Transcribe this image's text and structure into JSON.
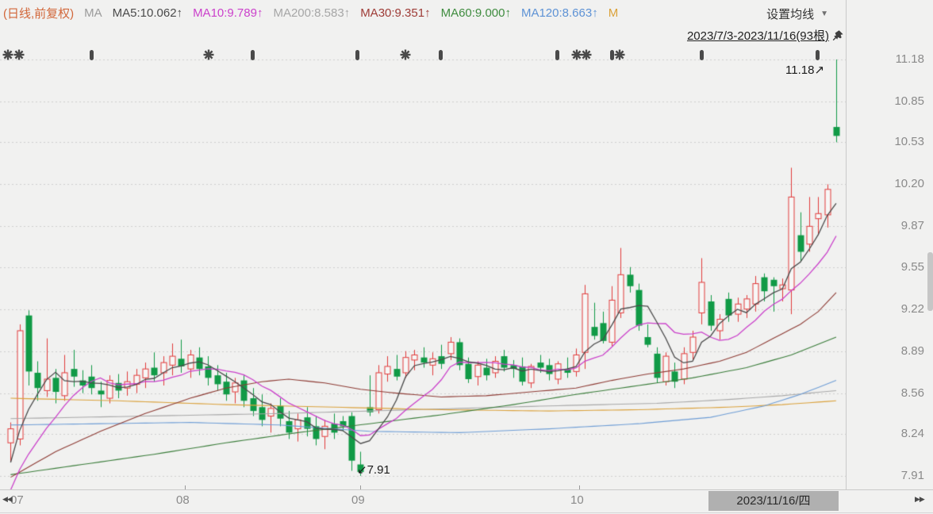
{
  "colors": {
    "background": "#f1f1f0",
    "grid": "#cfcfcf",
    "up": "#e13b3b",
    "up_fill": "#f7f7f6",
    "down": "#109a46",
    "axis_text": "#8a8a8a",
    "separator": "#c9c9c9",
    "annotation": "#1b1b1b",
    "marker": "#4a4a4a",
    "date_box_bg": "#b0b0b0",
    "date_box_text": "#2b2b2b",
    "scrollbar_thumb": "#c6c6c6"
  },
  "header": {
    "items": [
      {
        "name": "period-mode-label",
        "text": "(日线,前复权)",
        "color": "#d2673a"
      },
      {
        "name": "ma-group-label",
        "text": "MA",
        "color": "#9b9b9b"
      },
      {
        "name": "ma5-value",
        "text": "MA5:10.062↑",
        "color": "#4a4a4a"
      },
      {
        "name": "ma10-value",
        "text": "MA10:9.789↑",
        "color": "#cb41cb"
      },
      {
        "name": "ma200-value",
        "text": "MA200:8.583↑",
        "color": "#a6a6a6"
      },
      {
        "name": "ma30-value",
        "text": "MA30:9.351↑",
        "color": "#9e3b36"
      },
      {
        "name": "ma60-value",
        "text": "MA60:9.000↑",
        "color": "#3f8c3f"
      },
      {
        "name": "ma120-value",
        "text": "MA120:8.663↑",
        "color": "#5d92d5"
      },
      {
        "name": "ma250-truncated",
        "text": "M",
        "color": "#dba23a"
      }
    ],
    "settings_label": "设置均线",
    "date_range": "2023/7/3-2023/11/16(93根)"
  },
  "footer": {
    "month_labels": [
      {
        "label": "07",
        "x": 13
      },
      {
        "label": "08",
        "x": 233
      },
      {
        "label": "09",
        "x": 454
      },
      {
        "label": "10",
        "x": 730
      }
    ],
    "current_date": "2023/11/16/四"
  },
  "chart_data": {
    "type": "candlestick",
    "title": "日线 (daily) candlestick chart with moving averages",
    "date_start": "2023/7/3",
    "date_end": "2023/11/16",
    "bars_count": 93,
    "ylim": [
      7.91,
      11.18
    ],
    "price_axis_labels": [
      11.18,
      10.85,
      10.53,
      10.2,
      9.87,
      9.55,
      9.22,
      8.89,
      8.56,
      8.24,
      7.91
    ],
    "grid": "dotted-horizontal",
    "annotations": {
      "high": {
        "text": "11.18",
        "arrow": "↗",
        "price": 11.18
      },
      "low": {
        "text": "7.91",
        "arrow": "↙",
        "price": 7.91
      }
    },
    "ohlc": [
      [
        8.17,
        8.33,
        8.02,
        8.28
      ],
      [
        8.2,
        9.1,
        8.15,
        9.05
      ],
      [
        9.17,
        9.21,
        8.62,
        8.73
      ],
      [
        8.72,
        8.81,
        8.5,
        8.6
      ],
      [
        8.58,
        8.99,
        8.53,
        8.67
      ],
      [
        8.68,
        8.75,
        8.48,
        8.57
      ],
      [
        8.54,
        8.86,
        8.5,
        8.72
      ],
      [
        8.75,
        8.9,
        8.61,
        8.69
      ],
      [
        8.66,
        8.74,
        8.56,
        8.62
      ],
      [
        8.69,
        8.78,
        8.55,
        8.6
      ],
      [
        8.58,
        8.65,
        8.45,
        8.55
      ],
      [
        8.52,
        8.7,
        8.48,
        8.66
      ],
      [
        8.64,
        8.71,
        8.52,
        8.58
      ],
      [
        8.6,
        8.73,
        8.54,
        8.65
      ],
      [
        8.63,
        8.75,
        8.56,
        8.7
      ],
      [
        8.68,
        8.8,
        8.6,
        8.75
      ],
      [
        8.76,
        8.88,
        8.65,
        8.7
      ],
      [
        8.72,
        8.85,
        8.62,
        8.8
      ],
      [
        8.78,
        8.95,
        8.7,
        8.85
      ],
      [
        8.83,
        8.98,
        8.72,
        8.77
      ],
      [
        8.75,
        8.9,
        8.68,
        8.86
      ],
      [
        8.84,
        8.92,
        8.7,
        8.75
      ],
      [
        8.77,
        8.85,
        8.62,
        8.68
      ],
      [
        8.7,
        8.78,
        8.58,
        8.63
      ],
      [
        8.65,
        8.72,
        8.5,
        8.55
      ],
      [
        8.57,
        8.68,
        8.48,
        8.64
      ],
      [
        8.66,
        8.7,
        8.45,
        8.5
      ],
      [
        8.52,
        8.6,
        8.38,
        8.42
      ],
      [
        8.45,
        8.55,
        8.3,
        8.35
      ],
      [
        8.38,
        8.48,
        8.25,
        8.44
      ],
      [
        8.46,
        8.52,
        8.3,
        8.36
      ],
      [
        8.34,
        8.42,
        8.2,
        8.25
      ],
      [
        8.28,
        8.4,
        8.18,
        8.35
      ],
      [
        8.37,
        8.45,
        8.22,
        8.28
      ],
      [
        8.3,
        8.38,
        8.15,
        8.2
      ],
      [
        8.22,
        8.35,
        8.12,
        8.3
      ],
      [
        8.32,
        8.4,
        8.2,
        8.25
      ],
      [
        8.34,
        8.38,
        8.26,
        8.3
      ],
      [
        8.38,
        8.41,
        7.95,
        8.03
      ],
      [
        8.0,
        8.1,
        7.91,
        7.94
      ],
      [
        8.45,
        8.7,
        8.38,
        8.41
      ],
      [
        8.43,
        8.78,
        8.4,
        8.72
      ],
      [
        8.71,
        8.85,
        8.65,
        8.77
      ],
      [
        8.75,
        8.86,
        8.66,
        8.69
      ],
      [
        8.72,
        8.89,
        8.68,
        8.84
      ],
      [
        8.82,
        8.9,
        8.74,
        8.86
      ],
      [
        8.84,
        8.92,
        8.76,
        8.8
      ],
      [
        8.78,
        8.88,
        8.7,
        8.83
      ],
      [
        8.85,
        8.94,
        8.75,
        8.79
      ],
      [
        8.87,
        9.0,
        8.82,
        8.96
      ],
      [
        8.96,
        8.99,
        8.74,
        8.78
      ],
      [
        8.79,
        8.84,
        8.64,
        8.67
      ],
      [
        8.69,
        8.81,
        8.62,
        8.78
      ],
      [
        8.76,
        8.83,
        8.66,
        8.7
      ],
      [
        8.72,
        8.85,
        8.68,
        8.81
      ],
      [
        8.85,
        8.9,
        8.73,
        8.76
      ],
      [
        8.78,
        8.82,
        8.68,
        8.75
      ],
      [
        8.77,
        8.84,
        8.62,
        8.65
      ],
      [
        8.64,
        8.79,
        8.6,
        8.77
      ],
      [
        8.8,
        8.86,
        8.72,
        8.76
      ],
      [
        8.78,
        8.83,
        8.66,
        8.71
      ],
      [
        8.67,
        8.81,
        8.63,
        8.79
      ],
      [
        8.75,
        8.84,
        8.68,
        8.72
      ],
      [
        8.73,
        8.91,
        8.69,
        8.86
      ],
      [
        8.88,
        9.41,
        8.75,
        9.34
      ],
      [
        9.08,
        9.27,
        8.98,
        9.01
      ],
      [
        9.11,
        9.2,
        8.95,
        8.97
      ],
      [
        8.96,
        9.4,
        8.93,
        9.29
      ],
      [
        9.19,
        9.7,
        9.15,
        9.49
      ],
      [
        9.49,
        9.55,
        9.35,
        9.4
      ],
      [
        9.37,
        9.42,
        9.05,
        9.09
      ],
      [
        9.0,
        9.1,
        8.92,
        8.94
      ],
      [
        8.87,
        8.92,
        8.64,
        8.68
      ],
      [
        8.65,
        8.88,
        8.62,
        8.85
      ],
      [
        8.73,
        8.8,
        8.6,
        8.65
      ],
      [
        8.67,
        8.92,
        8.63,
        8.87
      ],
      [
        8.88,
        9.05,
        8.82,
        9.0
      ],
      [
        9.19,
        9.62,
        9.1,
        9.43
      ],
      [
        9.28,
        9.33,
        9.05,
        9.09
      ],
      [
        9.05,
        9.18,
        8.98,
        9.14
      ],
      [
        9.3,
        9.35,
        9.12,
        9.17
      ],
      [
        9.18,
        9.31,
        9.12,
        9.26
      ],
      [
        9.22,
        9.33,
        9.15,
        9.3
      ],
      [
        9.26,
        9.48,
        9.2,
        9.42
      ],
      [
        9.47,
        9.5,
        9.28,
        9.36
      ],
      [
        9.45,
        9.47,
        9.2,
        9.4
      ],
      [
        9.38,
        9.46,
        9.28,
        9.41
      ],
      [
        9.37,
        10.33,
        9.18,
        10.1
      ],
      [
        9.8,
        9.98,
        9.59,
        9.67
      ],
      [
        9.73,
        10.1,
        9.67,
        9.87
      ],
      [
        9.93,
        10.1,
        9.8,
        9.97
      ],
      [
        9.96,
        10.2,
        9.86,
        10.16
      ],
      [
        10.65,
        11.18,
        10.53,
        10.58
      ]
    ],
    "pre_window_closes": [
      7.4,
      7.45,
      7.52,
      7.58,
      7.65,
      7.72,
      7.8,
      7.9,
      8.0,
      8.1
    ],
    "ma_computed": [
      {
        "name": "MA5",
        "period": 5,
        "color": "#4a4a4a",
        "last_value": 10.062
      },
      {
        "name": "MA10",
        "period": 10,
        "color": "#cb41cb",
        "last_value": 9.789
      }
    ],
    "ma_lines": [
      {
        "name": "MA200",
        "color": "#a8a8a8",
        "last_value": 8.583,
        "points": [
          [
            0,
            8.36
          ],
          [
            15,
            8.38
          ],
          [
            30,
            8.4
          ],
          [
            45,
            8.43
          ],
          [
            60,
            8.46
          ],
          [
            72,
            8.48
          ],
          [
            80,
            8.51
          ],
          [
            86,
            8.54
          ],
          [
            92,
            8.58
          ]
        ]
      },
      {
        "name": "MA250",
        "color": "#dba23c",
        "points": [
          [
            0,
            8.52
          ],
          [
            12,
            8.5
          ],
          [
            24,
            8.47
          ],
          [
            36,
            8.45
          ],
          [
            48,
            8.43
          ],
          [
            60,
            8.42
          ],
          [
            70,
            8.43
          ],
          [
            80,
            8.45
          ],
          [
            86,
            8.47
          ],
          [
            92,
            8.5
          ]
        ]
      },
      {
        "name": "MA120",
        "color": "#6f9ed6",
        "last_value": 8.663,
        "points": [
          [
            0,
            8.31
          ],
          [
            10,
            8.32
          ],
          [
            20,
            8.33
          ],
          [
            30,
            8.31
          ],
          [
            40,
            8.26
          ],
          [
            50,
            8.25
          ],
          [
            60,
            8.28
          ],
          [
            70,
            8.32
          ],
          [
            78,
            8.37
          ],
          [
            84,
            8.46
          ],
          [
            88,
            8.55
          ],
          [
            92,
            8.66
          ]
        ]
      },
      {
        "name": "MA60",
        "color": "#3a7d3a",
        "last_value": 9.0,
        "points": [
          [
            0,
            7.92
          ],
          [
            8,
            8.0
          ],
          [
            16,
            8.08
          ],
          [
            24,
            8.17
          ],
          [
            32,
            8.25
          ],
          [
            40,
            8.32
          ],
          [
            48,
            8.39
          ],
          [
            56,
            8.47
          ],
          [
            63,
            8.55
          ],
          [
            70,
            8.62
          ],
          [
            76,
            8.68
          ],
          [
            82,
            8.76
          ],
          [
            87,
            8.86
          ],
          [
            92,
            9.0
          ]
        ]
      },
      {
        "name": "MA30",
        "color": "#8e3b34",
        "last_value": 9.351,
        "points": [
          [
            0,
            7.9
          ],
          [
            5,
            8.1
          ],
          [
            10,
            8.26
          ],
          [
            15,
            8.4
          ],
          [
            20,
            8.52
          ],
          [
            24,
            8.6
          ],
          [
            28,
            8.65
          ],
          [
            31,
            8.67
          ],
          [
            35,
            8.64
          ],
          [
            39,
            8.59
          ],
          [
            43,
            8.56
          ],
          [
            48,
            8.53
          ],
          [
            53,
            8.54
          ],
          [
            58,
            8.57
          ],
          [
            63,
            8.6
          ],
          [
            67,
            8.66
          ],
          [
            71,
            8.71
          ],
          [
            75,
            8.75
          ],
          [
            79,
            8.81
          ],
          [
            82,
            8.88
          ],
          [
            85,
            8.99
          ],
          [
            88,
            9.1
          ],
          [
            90,
            9.2
          ],
          [
            92,
            9.35
          ]
        ]
      }
    ],
    "event_markers": [
      {
        "type": "asterisk",
        "x": 10
      },
      {
        "type": "asterisk",
        "x": 24
      },
      {
        "type": "capsule",
        "x": 115
      },
      {
        "type": "asterisk",
        "x": 263
      },
      {
        "type": "capsule",
        "x": 318
      },
      {
        "type": "capsule",
        "x": 450
      },
      {
        "type": "asterisk",
        "x": 511
      },
      {
        "type": "capsule",
        "x": 555
      },
      {
        "type": "capsule",
        "x": 702
      },
      {
        "type": "asterisk",
        "x": 727
      },
      {
        "type": "asterisk",
        "x": 739
      },
      {
        "type": "capsule",
        "x": 771
      },
      {
        "type": "asterisk",
        "x": 781
      },
      {
        "type": "capsule",
        "x": 884
      },
      {
        "type": "capsule",
        "x": 1030
      }
    ]
  }
}
